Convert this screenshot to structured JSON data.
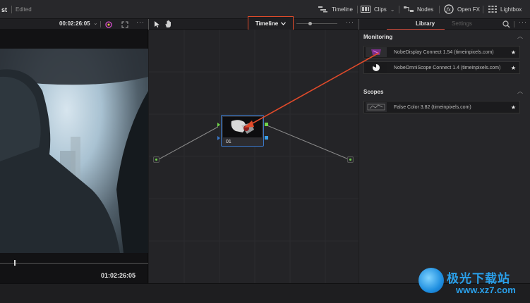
{
  "app": {
    "project_title": "st",
    "edit_status": "Edited"
  },
  "toolbar": {
    "timeline_label": "Timeline",
    "clips_label": "Clips",
    "nodes_label": "Nodes",
    "openfx_label": "Open FX",
    "lightbox_label": "Lightbox"
  },
  "viewer": {
    "header_timecode": "00:02:26:05",
    "current_timecode": "01:02:26:05"
  },
  "nodegraph": {
    "mode_dropdown_label": "Timeline",
    "node": {
      "label": "01"
    }
  },
  "library": {
    "tabs": [
      {
        "label": "Library"
      },
      {
        "label": "Settings"
      }
    ],
    "sections": [
      {
        "title": "Monitoring",
        "items": [
          {
            "name": "NobeDisplay Connect 1.54 (timeinpixels.com)"
          },
          {
            "name": "NobeOmniScope Connect 1.4 (timeinpixels.com)"
          }
        ]
      },
      {
        "title": "Scopes",
        "items": [
          {
            "name": "False Color 3.82 (timeinpixels.com)"
          }
        ]
      }
    ]
  },
  "watermark": {
    "title": "极光下载站",
    "url": "www.xz7.com"
  },
  "colors": {
    "highlight_box": "#e04a2a",
    "tab_underline": "#d24a3a",
    "node_border": "#3a78c8",
    "port_green": "#6fd34a"
  }
}
